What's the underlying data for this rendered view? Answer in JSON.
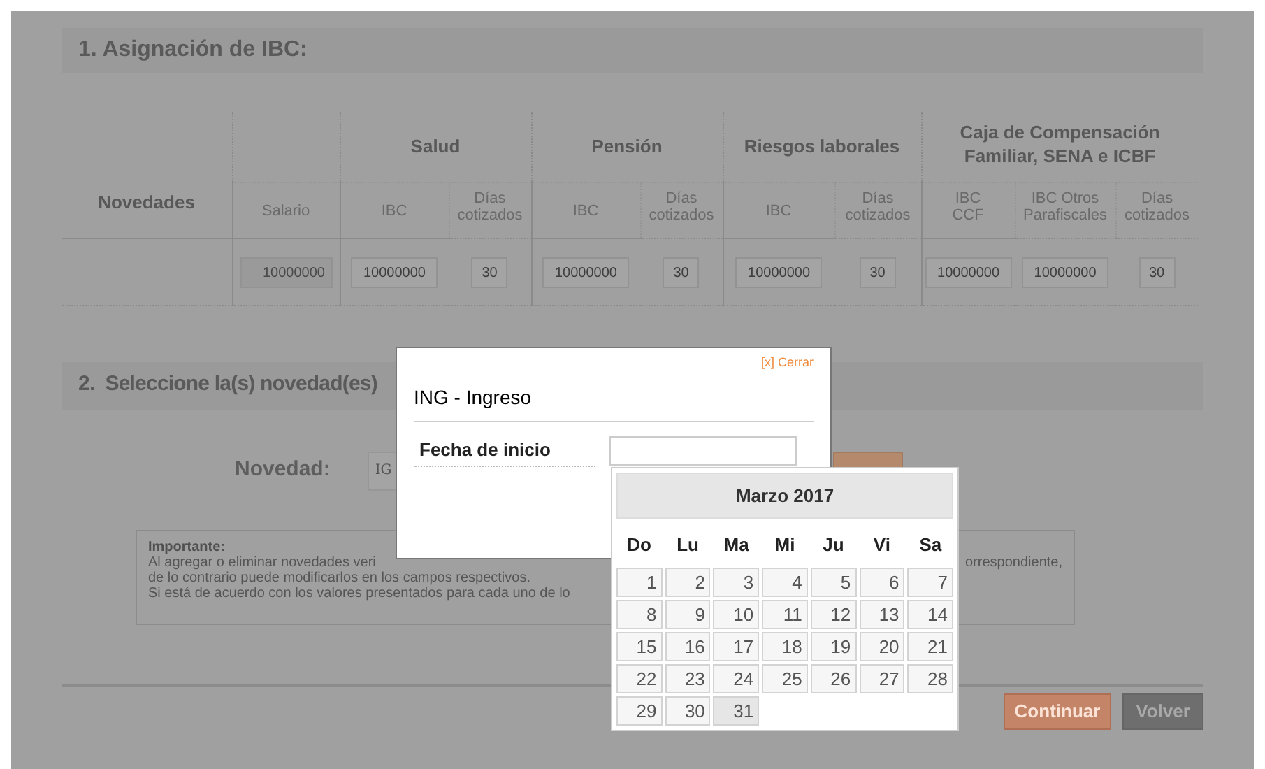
{
  "section_1": {
    "title": "1. Asignación de IBC:",
    "table": {
      "row_header": "Novedades",
      "groups": [
        {
          "columns": [
            {
              "label": "Salario",
              "value": "10000000",
              "disabled": true
            }
          ]
        },
        {
          "label": "Salud",
          "columns": [
            {
              "label": "IBC",
              "value": "10000000",
              "disabled": false
            },
            {
              "label": "Días\ncotizados",
              "value": "30",
              "disabled": false
            }
          ]
        },
        {
          "label": "Pensión",
          "columns": [
            {
              "label": "IBC",
              "value": "10000000",
              "disabled": false
            },
            {
              "label": "Días\ncotizados",
              "value": "30",
              "disabled": false
            }
          ]
        },
        {
          "label": "Riesgos laborales",
          "columns": [
            {
              "label": "IBC",
              "value": "10000000",
              "disabled": false
            },
            {
              "label": "Días\ncotizados",
              "value": "30",
              "disabled": false
            }
          ]
        },
        {
          "label": "Caja de Compensación\nFamiliar, SENA e ICBF",
          "columns": [
            {
              "label": "IBC\nCCF",
              "value": "10000000",
              "disabled": false
            },
            {
              "label": "IBC Otros\nParafiscales",
              "value": "10000000",
              "disabled": false
            },
            {
              "label": "Días\ncotizados",
              "value": "30",
              "disabled": false
            }
          ]
        }
      ]
    }
  },
  "section_2": {
    "title": "2.  Seleccione la(s) novedad(es)",
    "novedad_label": "Novedad:",
    "novedad_value": "IG",
    "notice": {
      "heading": "Importante:",
      "lines": [
        {
          "left": "Al agregar o eliminar novedades veri",
          "right": "orrespondiente,"
        },
        {
          "left": "de lo contrario puede modificarlos en los campos respectivos."
        },
        {
          "left": "Si está de acuerdo con los valores presentados para cada uno de lo"
        }
      ]
    }
  },
  "buttons": [
    {
      "label": "Continuar",
      "kind": "primary"
    },
    {
      "label": "Volver",
      "kind": "secondary"
    }
  ],
  "modal": {
    "close": "[x] Cerrar",
    "title": "ING - Ingreso",
    "field_label": "Fecha de inicio"
  },
  "calendar": {
    "title": "Marzo 2017",
    "weekdays": [
      "Do",
      "Lu",
      "Ma",
      "Mi",
      "Ju",
      "Vi",
      "Sa"
    ],
    "weeks": [
      [
        {
          "day": "1",
          "today": false
        },
        {
          "day": "2",
          "today": false
        },
        {
          "day": "3",
          "today": false
        },
        {
          "day": "4",
          "today": false
        },
        {
          "day": "5",
          "today": false
        },
        {
          "day": "6",
          "today": false
        },
        {
          "day": "7",
          "today": false
        }
      ],
      [
        {
          "day": "8",
          "today": false
        },
        {
          "day": "9",
          "today": false
        },
        {
          "day": "10",
          "today": false
        },
        {
          "day": "11",
          "today": false
        },
        {
          "day": "12",
          "today": false
        },
        {
          "day": "13",
          "today": false
        },
        {
          "day": "14",
          "today": false
        }
      ],
      [
        {
          "day": "15",
          "today": false
        },
        {
          "day": "16",
          "today": false
        },
        {
          "day": "17",
          "today": false
        },
        {
          "day": "18",
          "today": false
        },
        {
          "day": "19",
          "today": false
        },
        {
          "day": "20",
          "today": false
        },
        {
          "day": "21",
          "today": false
        }
      ],
      [
        {
          "day": "22",
          "today": false
        },
        {
          "day": "23",
          "today": false
        },
        {
          "day": "24",
          "today": false
        },
        {
          "day": "25",
          "today": false
        },
        {
          "day": "26",
          "today": false
        },
        {
          "day": "27",
          "today": false
        },
        {
          "day": "28",
          "today": false
        }
      ],
      [
        {
          "day": "29",
          "today": false
        },
        {
          "day": "30",
          "today": false
        },
        {
          "day": "31",
          "today": true
        }
      ]
    ]
  }
}
